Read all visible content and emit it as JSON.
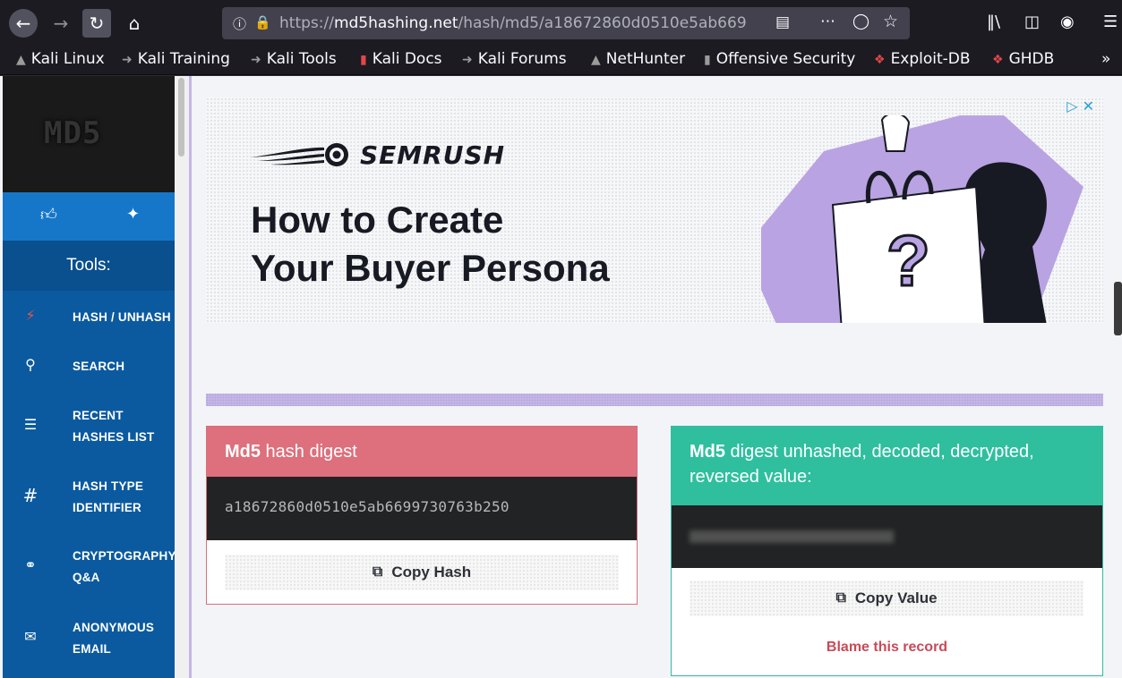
{
  "browser": {
    "url_scheme": "https://",
    "url_host": "md5hashing.net",
    "url_path": "/hash/md5/a18672860d0510e5ab669",
    "bookmarks": [
      "Kali Linux",
      "Kali Training",
      "Kali Tools",
      "Kali Docs",
      "Kali Forums",
      "NetHunter",
      "Offensive Security",
      "Exploit-DB",
      "GHDB"
    ]
  },
  "sidebar": {
    "logo": "MD5",
    "tools_heading": "Tools:",
    "items": [
      {
        "label": "HASH / UNHASH",
        "icon": "bolt-icon"
      },
      {
        "label": "SEARCH",
        "icon": "search-icon"
      },
      {
        "label": "RECENT HASHES LIST",
        "icon": "list-icon"
      },
      {
        "label": "HASH TYPE IDENTIFIER",
        "icon": "hash-icon"
      },
      {
        "label": "CRYPTOGRAPHY Q&A",
        "icon": "chat-icon"
      },
      {
        "label": "ANONYMOUS EMAIL",
        "icon": "envelope-icon"
      }
    ]
  },
  "ad": {
    "brand": "SEMRUSH",
    "headline_line1": "How to Create",
    "headline_line2": "Your Buyer Persona"
  },
  "digest_card": {
    "title_bold": "Md5",
    "title_rest": " hash digest",
    "hash": "a18672860d0510e5ab6699730763b250",
    "copy_label": "Copy Hash"
  },
  "result_card": {
    "title_bold": "Md5",
    "title_rest": " digest unhashed, decoded, decrypted, reversed value:",
    "copy_label": "Copy Value",
    "blame_label": "Blame this record"
  },
  "colors": {
    "sidebar": "#0b5aa0",
    "digest_header": "#de6f7c",
    "result_header": "#2fbf9e",
    "ad_accent": "#b9a3e3"
  }
}
